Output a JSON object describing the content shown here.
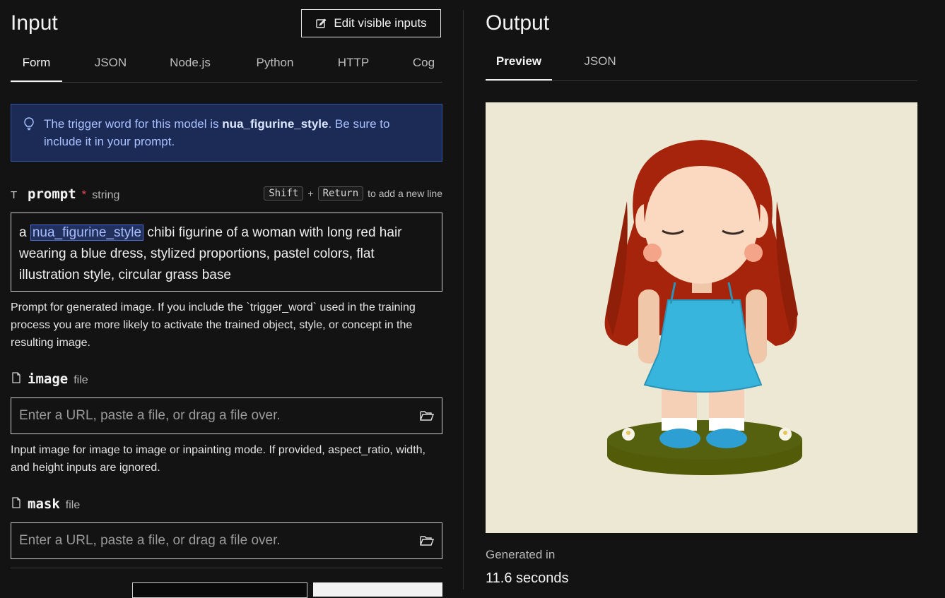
{
  "input": {
    "title": "Input",
    "edit_button": "Edit visible inputs",
    "tabs": [
      "Form",
      "JSON",
      "Node.js",
      "Python",
      "HTTP",
      "Cog"
    ],
    "active_tab": "Form",
    "callout": {
      "prefix": "The trigger word for this model is ",
      "trigger_word": "nua_figurine_style",
      "suffix": ". Be sure to include it in your prompt."
    },
    "prompt": {
      "label": "prompt",
      "required_mark": "*",
      "type": "string",
      "hint_keys": [
        "Shift",
        "Return"
      ],
      "hint_plus": "+",
      "hint_text": "to add a new line",
      "value_prefix": "a ",
      "value_highlight": "nua_figurine_style",
      "value_suffix": " chibi figurine of a woman with long red hair wearing a blue dress, stylized proportions, pastel colors, flat illustration style, circular grass base",
      "description": "Prompt for generated image. If you include the `trigger_word` used in the training process you are more likely to activate the trained object, style, or concept in the resulting image."
    },
    "image": {
      "label": "image",
      "type": "file",
      "placeholder": "Enter a URL, paste a file, or drag a file over.",
      "description": "Input image for image to image or inpainting mode. If provided, aspect_ratio, width, and height inputs are ignored."
    },
    "mask": {
      "label": "mask",
      "type": "file",
      "placeholder": "Enter a URL, paste a file, or drag a file over."
    }
  },
  "output": {
    "title": "Output",
    "tabs": [
      "Preview",
      "JSON"
    ],
    "active_tab": "Preview",
    "generated_label": "Generated in",
    "generated_value": "11.6 seconds"
  },
  "colors": {
    "background": "#131313",
    "callout_bg": "#1b2b55",
    "callout_text": "#a9c0ff",
    "required": "#e5484d",
    "preview_bg": "#ece8d3"
  }
}
